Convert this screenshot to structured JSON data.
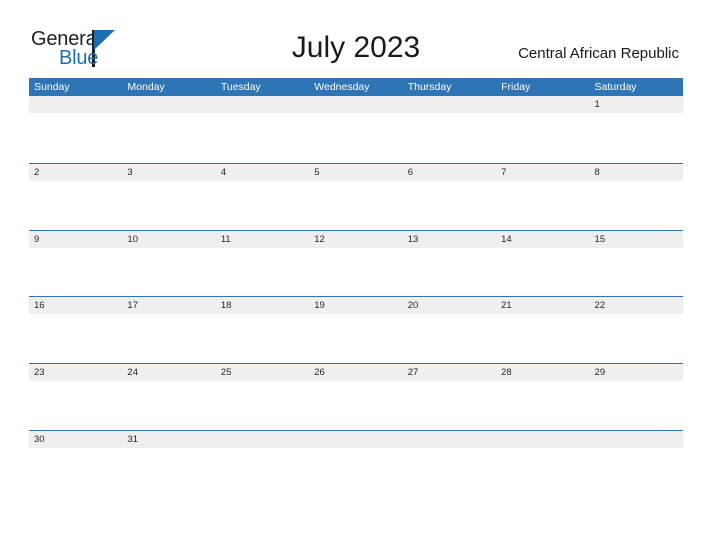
{
  "branding": {
    "logo_primary": "General",
    "logo_secondary": "Blue",
    "triangle_icon": "logo-triangle-icon",
    "accent_color": "#1f6db3"
  },
  "header": {
    "title": "July 2023",
    "country": "Central African Republic"
  },
  "calendar": {
    "header_bg_color": "#2e75b6",
    "row_band_color": "#efefef",
    "month": "July",
    "year": "2023",
    "day_names": [
      "Sunday",
      "Monday",
      "Tuesday",
      "Wednesday",
      "Thursday",
      "Friday",
      "Saturday"
    ],
    "weeks": [
      {
        "days": [
          "",
          "",
          "",
          "",
          "",
          "",
          "1"
        ]
      },
      {
        "days": [
          "2",
          "3",
          "4",
          "5",
          "6",
          "7",
          "8"
        ]
      },
      {
        "days": [
          "9",
          "10",
          "11",
          "12",
          "13",
          "14",
          "15"
        ]
      },
      {
        "days": [
          "16",
          "17",
          "18",
          "19",
          "20",
          "21",
          "22"
        ]
      },
      {
        "days": [
          "23",
          "24",
          "25",
          "26",
          "27",
          "28",
          "29"
        ]
      },
      {
        "days": [
          "30",
          "31",
          "",
          "",
          "",
          "",
          ""
        ]
      }
    ]
  }
}
